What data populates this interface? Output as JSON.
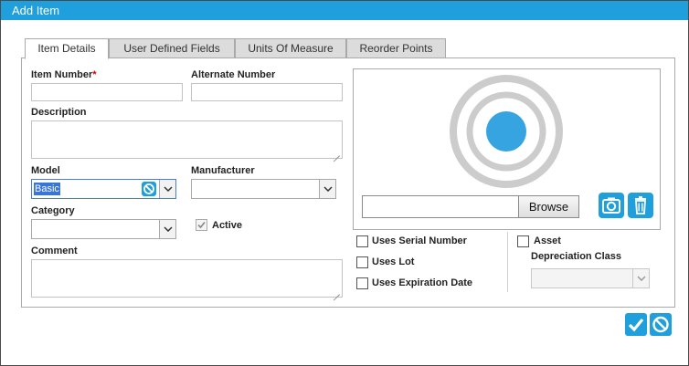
{
  "window": {
    "title": "Add Item"
  },
  "tabs": [
    {
      "label": "Item Details"
    },
    {
      "label": "User Defined Fields"
    },
    {
      "label": "Units Of Measure"
    },
    {
      "label": "Reorder Points"
    }
  ],
  "form": {
    "item_number": {
      "label": "Item Number",
      "required_mark": "*",
      "value": ""
    },
    "alternate_number": {
      "label": "Alternate Number",
      "value": ""
    },
    "description": {
      "label": "Description",
      "value": ""
    },
    "model": {
      "label": "Model",
      "value": "Basic"
    },
    "manufacturer": {
      "label": "Manufacturer",
      "value": ""
    },
    "category": {
      "label": "Category",
      "value": ""
    },
    "active": {
      "label": "Active",
      "checked": true
    },
    "comment": {
      "label": "Comment",
      "value": ""
    },
    "image": {
      "browse_label": "Browse",
      "file_path": ""
    },
    "uses_serial_number": {
      "label": "Uses Serial Number",
      "checked": false
    },
    "uses_lot": {
      "label": "Uses Lot",
      "checked": false
    },
    "uses_expiration_date": {
      "label": "Uses Expiration Date",
      "checked": false
    },
    "asset": {
      "label": "Asset",
      "checked": false
    },
    "depreciation_class": {
      "label": "Depreciation Class",
      "value": ""
    }
  },
  "icons": {
    "image_placeholder": "target-icon",
    "camera": "camera-icon",
    "delete": "trash-icon",
    "clear": "clear-icon",
    "save": "checkmark-icon",
    "cancel": "cancel-icon"
  },
  "colors": {
    "accent": "#1f9fdb",
    "placeholder_ring": "#cccccc",
    "placeholder_dot": "#36a4e0",
    "required": "#d40000"
  }
}
